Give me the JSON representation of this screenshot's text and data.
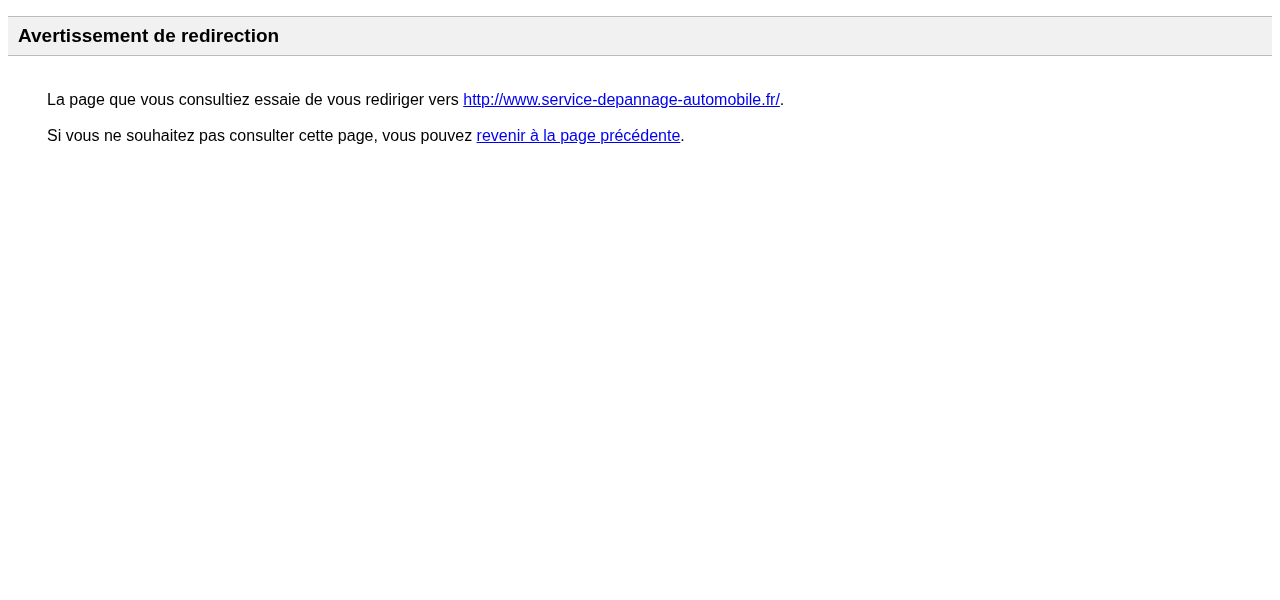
{
  "header": {
    "title": "Avertissement de redirection"
  },
  "paragraphs": [
    {
      "before": "La page que vous consultiez essaie de vous rediriger vers ",
      "link": "http://www.service-depannage-automobile.fr/",
      "after": "."
    },
    {
      "before": "Si vous ne souhaitez pas consulter cette page, vous pouvez ",
      "link": "revenir à la page précédente",
      "after": "."
    }
  ]
}
